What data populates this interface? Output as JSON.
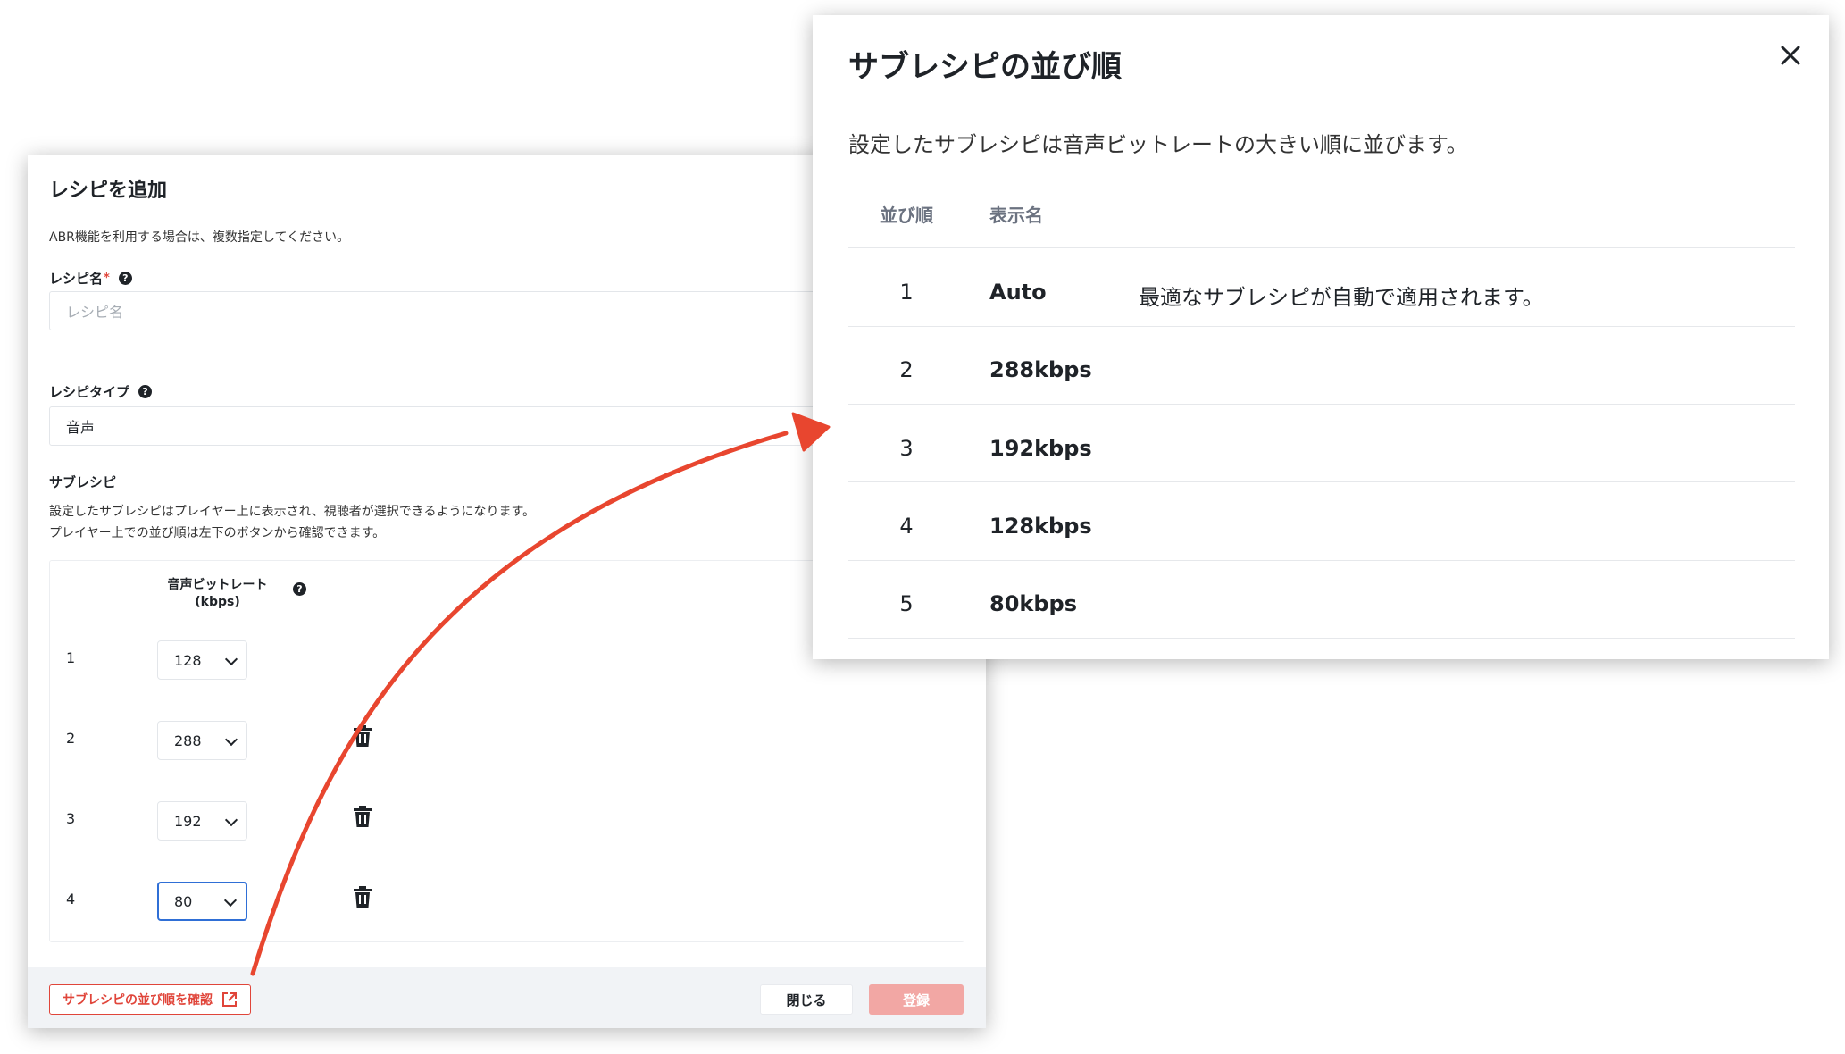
{
  "add_recipe_dialog": {
    "title": "レシピを追加",
    "description": "ABR機能を利用する場合は、複数指定してください。",
    "recipe_name": {
      "label": "レシピ名",
      "required_mark": "*",
      "placeholder": "レシピ名",
      "help_icon": "?"
    },
    "recipe_type": {
      "label": "レシピタイプ",
      "value": "音声",
      "help_icon": "?"
    },
    "subrecipe": {
      "label": "サブレシピ",
      "desc_line1": "設定したサブレシピはプレイヤー上に表示され、視聴者が選択できるようになります。",
      "desc_line2": "プレイヤー上での並び順は左下のボタンから確認できます。",
      "column_header_line1": "音声ビットレート",
      "column_header_line2": "(kbps)",
      "column_help_icon": "?",
      "rows": [
        {
          "num": "1",
          "bitrate": "128",
          "deletable": false,
          "focused": false
        },
        {
          "num": "2",
          "bitrate": "288",
          "deletable": true,
          "focused": false
        },
        {
          "num": "3",
          "bitrate": "192",
          "deletable": true,
          "focused": false
        },
        {
          "num": "4",
          "bitrate": "80",
          "deletable": true,
          "focused": true
        }
      ]
    },
    "footer": {
      "sub_order_button": "サブレシピの並び順を確認",
      "close_button": "閉じる",
      "register_button": "登録"
    }
  },
  "sub_order_dialog": {
    "title": "サブレシピの並び順",
    "description": "設定したサブレシピは音声ビットレートの大きい順に並びます。",
    "columns": {
      "order": "並び順",
      "display_name": "表示名"
    },
    "rows": [
      {
        "order": "1",
        "name": "Auto",
        "note": "最適なサブレシピが自動で適用されます。"
      },
      {
        "order": "2",
        "name": "288kbps",
        "note": ""
      },
      {
        "order": "3",
        "name": "192kbps",
        "note": ""
      },
      {
        "order": "4",
        "name": "128kbps",
        "note": ""
      },
      {
        "order": "5",
        "name": "80kbps",
        "note": ""
      }
    ]
  },
  "colors": {
    "accent_red": "#e0453a",
    "register_disabled": "#f2a7a4",
    "focus_blue": "#2f6fd6",
    "arrow_red": "#e8462f"
  }
}
